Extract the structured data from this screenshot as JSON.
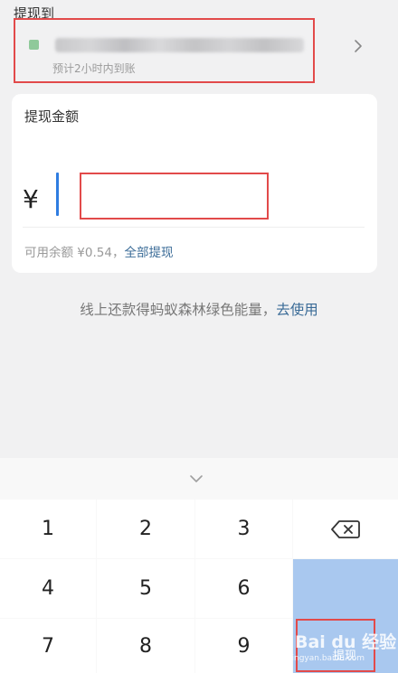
{
  "header": {
    "withdraw_to_label": "提现到",
    "arrival_hint": "预计2小时内到账",
    "accent_color": "#8fc99a"
  },
  "amount_card": {
    "title": "提现金额",
    "currency_symbol": "¥",
    "amount_value": "",
    "balance_text": "可用余额 ¥0.54，",
    "withdraw_all_label": "全部提现"
  },
  "promo": {
    "text": "线上还款得蚂蚁森林绿色能量，",
    "link_label": "去使用"
  },
  "keyboard": {
    "keys": {
      "k1": "1",
      "k2": "2",
      "k3": "3",
      "k4": "4",
      "k5": "5",
      "k6": "6",
      "k7": "7",
      "k8": "8",
      "k9": "9"
    },
    "confirm_label": "提现",
    "confirm_color": "#a9c8ef",
    "icons": [
      "chevron-down-icon",
      "backspace-icon"
    ]
  },
  "highlight_color": "#e24a4a",
  "link_color": "#3a6b97",
  "watermark": {
    "brand": "Bai du 经验",
    "url": "jingyan.baidu.com"
  }
}
